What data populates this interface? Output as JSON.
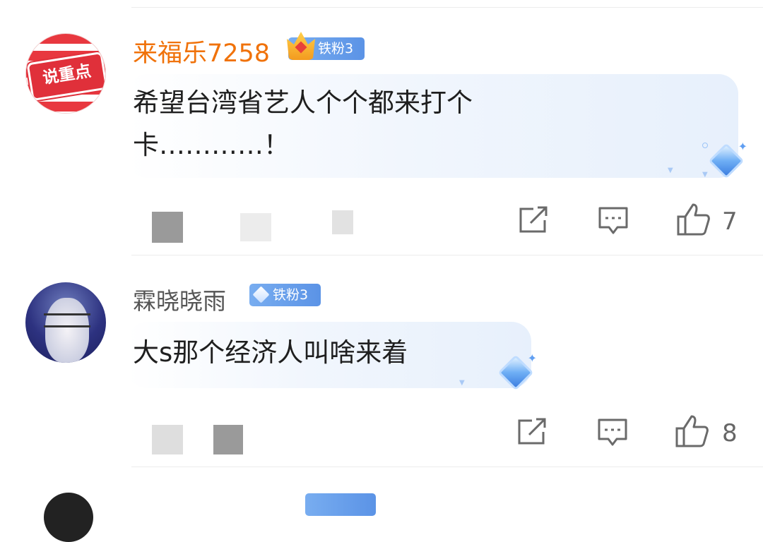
{
  "comments": [
    {
      "avatar_label": "说重点",
      "username": "来福乐7258",
      "badge": "铁粉3",
      "badge_icon": "crown-icon",
      "text": "希望台湾省艺人个个都来打个卡…………！",
      "like_count": "7"
    },
    {
      "username": "霖晓晓雨",
      "badge": "铁粉3",
      "badge_icon": "diamond-icon",
      "text": "大s那个经济人叫啥来着",
      "like_count": "8"
    }
  ],
  "colors": {
    "vip_username": "#f0720a",
    "badge_blue": "#5b93e6",
    "bubble_tint": "#e7f0fc"
  }
}
